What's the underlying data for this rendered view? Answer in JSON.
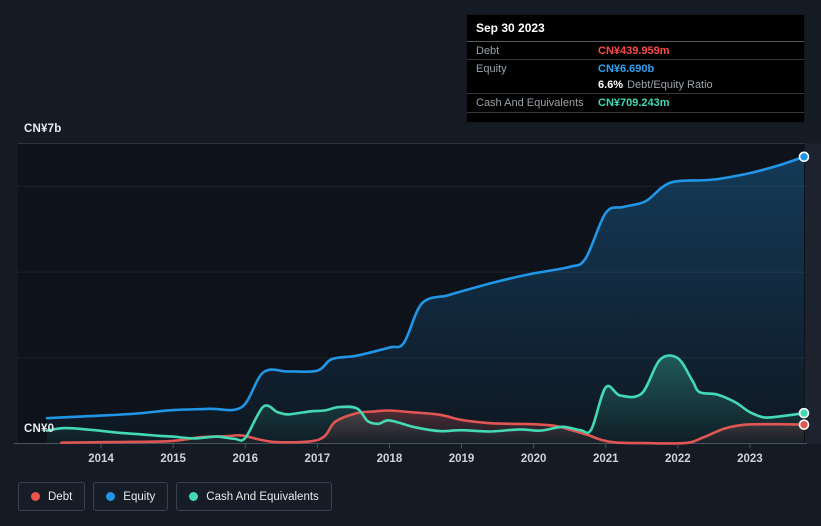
{
  "tooltip": {
    "date": "Sep 30 2023",
    "rows": [
      {
        "label": "Debt",
        "value": "CN¥439.959m",
        "color": "#fb4a49"
      },
      {
        "label": "Equity",
        "value": "CN¥6.690b",
        "color": "#2da1f0"
      },
      {
        "label": "Cash And Equivalents",
        "value": "CN¥709.243m",
        "color": "#3ed9b5"
      }
    ],
    "equity_ratio": {
      "value": "6.6%",
      "label": "Debt/Equity Ratio"
    }
  },
  "legend": [
    {
      "label": "Debt",
      "color": "#e8554d"
    },
    {
      "label": "Equity",
      "color": "#2196e6"
    },
    {
      "label": "Cash And Equivalents",
      "color": "#43d9b4"
    }
  ],
  "chart_data": {
    "type": "area",
    "unit": "CN¥ billions",
    "x_tick_labels": [
      "2014",
      "2015",
      "2016",
      "2017",
      "2018",
      "2019",
      "2020",
      "2021",
      "2022",
      "2023"
    ],
    "xlim": [
      2013.25,
      2023.75
    ],
    "y_axis": {
      "top_label": "CN¥7b",
      "zero_label": "CN¥0",
      "ylim": [
        0,
        7
      ],
      "gridlines_b": [
        7,
        6,
        4,
        2,
        0
      ]
    },
    "legend_position": "bottom-left",
    "series": [
      {
        "name": "Debt",
        "color": "#e15654",
        "points": [
          [
            2013.45,
            0.02
          ],
          [
            2014,
            0.03
          ],
          [
            2014.6,
            0.04
          ],
          [
            2015,
            0.06
          ],
          [
            2015.4,
            0.15
          ],
          [
            2015.75,
            0.17
          ],
          [
            2015.95,
            0.19
          ],
          [
            2016.2,
            0.09
          ],
          [
            2016.45,
            0.03
          ],
          [
            2016.9,
            0.05
          ],
          [
            2017.1,
            0.17
          ],
          [
            2017.25,
            0.51
          ],
          [
            2017.55,
            0.71
          ],
          [
            2017.8,
            0.75
          ],
          [
            2018,
            0.77
          ],
          [
            2018.3,
            0.73
          ],
          [
            2018.7,
            0.67
          ],
          [
            2019,
            0.55
          ],
          [
            2019.35,
            0.48
          ],
          [
            2019.65,
            0.46
          ],
          [
            2020,
            0.45
          ],
          [
            2020.3,
            0.41
          ],
          [
            2020.55,
            0.3
          ],
          [
            2020.75,
            0.2
          ],
          [
            2020.95,
            0.08
          ],
          [
            2021.15,
            0.02
          ],
          [
            2021.5,
            0.01
          ],
          [
            2022.1,
            0.01
          ],
          [
            2022.35,
            0.14
          ],
          [
            2022.65,
            0.35
          ],
          [
            2022.95,
            0.44
          ],
          [
            2023.4,
            0.45
          ],
          [
            2023.75,
            0.44
          ]
        ]
      },
      {
        "name": "Equity",
        "color": "#2196e6",
        "points": [
          [
            2013.25,
            0.59
          ],
          [
            2013.6,
            0.62
          ],
          [
            2014,
            0.65
          ],
          [
            2014.5,
            0.7
          ],
          [
            2015,
            0.78
          ],
          [
            2015.5,
            0.81
          ],
          [
            2015.95,
            0.85
          ],
          [
            2016.25,
            1.66
          ],
          [
            2016.6,
            1.68
          ],
          [
            2017,
            1.7
          ],
          [
            2017.2,
            1.97
          ],
          [
            2017.55,
            2.05
          ],
          [
            2018,
            2.24
          ],
          [
            2018.2,
            2.35
          ],
          [
            2018.45,
            3.27
          ],
          [
            2018.8,
            3.45
          ],
          [
            2019,
            3.55
          ],
          [
            2019.5,
            3.78
          ],
          [
            2020,
            3.97
          ],
          [
            2020.5,
            4.12
          ],
          [
            2020.72,
            4.32
          ],
          [
            2021,
            5.38
          ],
          [
            2021.25,
            5.52
          ],
          [
            2021.55,
            5.65
          ],
          [
            2021.8,
            6.0
          ],
          [
            2022,
            6.12
          ],
          [
            2022.5,
            6.16
          ],
          [
            2023,
            6.31
          ],
          [
            2023.4,
            6.49
          ],
          [
            2023.75,
            6.69
          ]
        ]
      },
      {
        "name": "Cash And Equivalents",
        "color": "#43d9b4",
        "points": [
          [
            2013.25,
            0.3
          ],
          [
            2013.5,
            0.36
          ],
          [
            2013.85,
            0.32
          ],
          [
            2014.2,
            0.26
          ],
          [
            2014.5,
            0.22
          ],
          [
            2014.8,
            0.18
          ],
          [
            2015,
            0.16
          ],
          [
            2015.3,
            0.12
          ],
          [
            2015.6,
            0.16
          ],
          [
            2015.85,
            0.11
          ],
          [
            2016,
            0.13
          ],
          [
            2016.25,
            0.86
          ],
          [
            2016.45,
            0.73
          ],
          [
            2016.6,
            0.68
          ],
          [
            2016.9,
            0.75
          ],
          [
            2017.1,
            0.77
          ],
          [
            2017.3,
            0.85
          ],
          [
            2017.55,
            0.82
          ],
          [
            2017.7,
            0.52
          ],
          [
            2017.85,
            0.46
          ],
          [
            2018,
            0.54
          ],
          [
            2018.35,
            0.38
          ],
          [
            2018.7,
            0.29
          ],
          [
            2019,
            0.31
          ],
          [
            2019.4,
            0.28
          ],
          [
            2019.8,
            0.33
          ],
          [
            2020.1,
            0.3
          ],
          [
            2020.4,
            0.39
          ],
          [
            2020.65,
            0.31
          ],
          [
            2020.8,
            0.33
          ],
          [
            2021,
            1.31
          ],
          [
            2021.2,
            1.12
          ],
          [
            2021.5,
            1.17
          ],
          [
            2021.75,
            1.95
          ],
          [
            2022,
            1.99
          ],
          [
            2022.2,
            1.47
          ],
          [
            2022.3,
            1.2
          ],
          [
            2022.55,
            1.14
          ],
          [
            2022.8,
            0.96
          ],
          [
            2023,
            0.73
          ],
          [
            2023.2,
            0.61
          ],
          [
            2023.45,
            0.64
          ],
          [
            2023.75,
            0.709
          ]
        ]
      }
    ],
    "end_markers_at": "2023.75"
  }
}
